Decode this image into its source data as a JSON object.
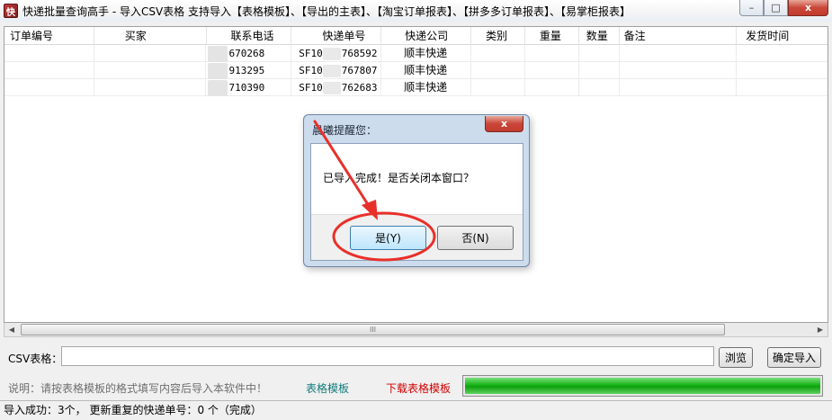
{
  "window": {
    "title": "快递批量查询高手 - 导入CSV表格 支持导入【表格模板】、【导出的主表】、【淘宝订单报表】、【拼多多订单报表】、【易掌柜报表】",
    "icon_glyph": "快",
    "min_glyph": "–",
    "max_glyph": "□",
    "close_glyph": "x"
  },
  "table": {
    "columns": [
      "订单编号",
      "买家",
      "联系电话",
      "快递单号",
      "快递公司",
      "类别",
      "重量",
      "数量",
      "备注",
      "发货时间"
    ],
    "rows": [
      {
        "order": "",
        "buyer": "",
        "phone": "670268",
        "tracking_prefix": "SF10",
        "tracking_suffix": "768592",
        "carrier": "顺丰快递"
      },
      {
        "order": "",
        "buyer": "",
        "phone": "913295",
        "tracking_prefix": "SF10",
        "tracking_suffix": "767807",
        "carrier": "顺丰快递"
      },
      {
        "order": "",
        "buyer": "",
        "phone": "710390",
        "tracking_prefix": "SF10",
        "tracking_suffix": "762683",
        "carrier": "顺丰快递"
      }
    ]
  },
  "scrollbar": {
    "left_arrow": "◀",
    "right_arrow": "▶",
    "grip": "III"
  },
  "csv": {
    "label": "CSV表格：",
    "value": "",
    "browse_label": "浏览",
    "import_label": "确定导入"
  },
  "hint": {
    "text": "说明：请按表格模板的格式填写内容后导入本软件中！",
    "template_link": "表格模板",
    "download_link": "下载表格模板"
  },
  "progress": {
    "percent": 100
  },
  "status": {
    "text": "导入成功：3个，  更新重复的快递单号：0 个（完成）"
  },
  "dialog": {
    "title": "晨曦提醒您：",
    "message": "已导入完成！是否关闭本窗口？",
    "yes_label": "是(Y)",
    "no_label": "否(N)",
    "close_glyph": "x"
  },
  "colors": {
    "annotation_red": "#e8302a",
    "progress_green": "#16b416",
    "link_teal": "#117a7a",
    "link_red": "#d10000"
  }
}
